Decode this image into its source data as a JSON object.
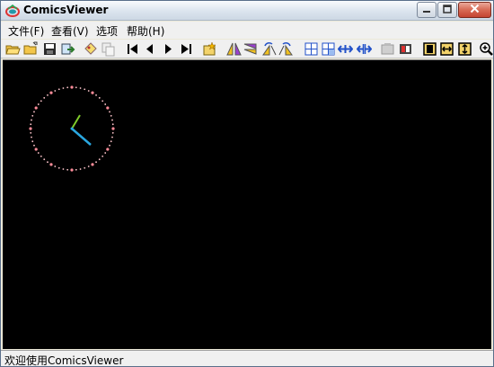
{
  "window": {
    "title": "ComicsViewer",
    "controls": [
      "minimize-icon",
      "maximize-icon",
      "close-icon"
    ]
  },
  "menubar": {
    "items": [
      {
        "label": "文件(F)",
        "name": "menu-file"
      },
      {
        "label": "查看(V)",
        "name": "menu-view"
      },
      {
        "label": "选项",
        "name": "menu-options"
      },
      {
        "label": "帮助(H)",
        "name": "menu-help"
      }
    ]
  },
  "toolbar": {
    "buttons": [
      "open-folder-icon",
      "open-file-icon",
      "save-icon",
      "convert-icon",
      "bookmark-icon",
      "copy-icon",
      "first-page-icon",
      "previous-page-icon",
      "next-page-icon",
      "last-page-icon",
      "new-window-icon",
      "flip-horizontal-icon",
      "flip-vertical-icon",
      "rotate-left-icon",
      "rotate-right-icon",
      "split-left-icon",
      "split-right-icon",
      "fit-width-arrows-icon",
      "fit-height-arrows-icon",
      "disabled-view-icon",
      "slideshow-icon",
      "fit-page-icon",
      "fit-width-icon",
      "fit-height-icon",
      "zoom-in-icon"
    ]
  },
  "colors": {
    "canvas": "#000000",
    "clock_dots": "#ff9ea8",
    "hour_hand": "#7fcc2a",
    "minute_hand": "#2aa7e0"
  },
  "statusbar": {
    "text": "欢迎使用ComicsViewer"
  }
}
